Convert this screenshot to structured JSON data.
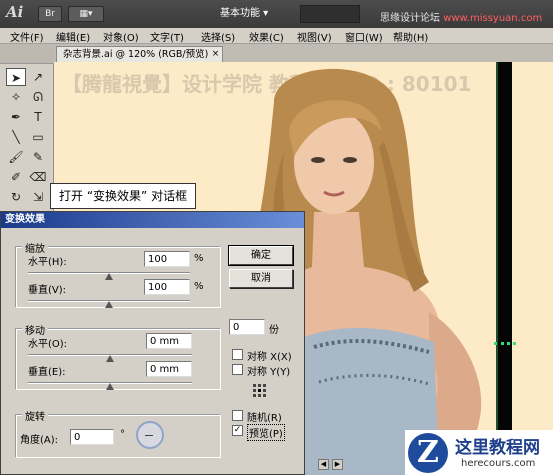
{
  "app": {
    "logo": "Ai",
    "bridge_button": "Br",
    "layout_button": "▦▾",
    "workspace": "基本功能 ▾",
    "watermark_prefix": "思缘设计论坛 ",
    "watermark_site": "www.missyuan.com"
  },
  "menu": [
    "文件(F)",
    "编辑(E)",
    "对象(O)",
    "文字(T)",
    "选择(S)",
    "效果(C)",
    "视图(V)",
    "窗口(W)",
    "帮助(H)"
  ],
  "document_tab": {
    "label": "杂志背景.ai @ 120% (RGB/预览)",
    "close": "×"
  },
  "canvas": {
    "watermark": "【腾龍視覺】设计学院  教程频道 ID : 80101"
  },
  "callout": "打开 “变换效果” 对话框",
  "dialog": {
    "title": "变换效果",
    "scale": {
      "title": "缩放",
      "h_label": "水平(H):",
      "h_value": "100",
      "h_unit": "%",
      "h_slider": 0.5,
      "v_label": "垂直(V):",
      "v_value": "100",
      "v_unit": "%",
      "v_slider": 0.5
    },
    "move": {
      "title": "移动",
      "h_label": "水平(O):",
      "h_value": "0 mm",
      "h_slider": 0.5,
      "v_label": "垂直(E):",
      "v_value": "0 mm",
      "v_slider": 0.5
    },
    "rotate": {
      "title": "旋转",
      "angle_label": "角度(A):",
      "angle_value": "0",
      "angle_unit": "°"
    },
    "ok": "确定",
    "cancel": "取消",
    "copies_value": "0",
    "copies_unit": "份",
    "reflect_x": "对称 X(X)",
    "reflect_y": "对称 Y(Y)",
    "random": "随机(R)",
    "preview": "预览(P)",
    "preview_checked": true
  },
  "logo": {
    "letter": "Z",
    "name": "这里教程网",
    "url": "herecours.com"
  },
  "colors": {
    "canvas_bg": "#fdebc8",
    "dialog_bg": "#d4d0c8",
    "title_grad_start": "#1a3a8a",
    "guide": "#2ee070"
  }
}
